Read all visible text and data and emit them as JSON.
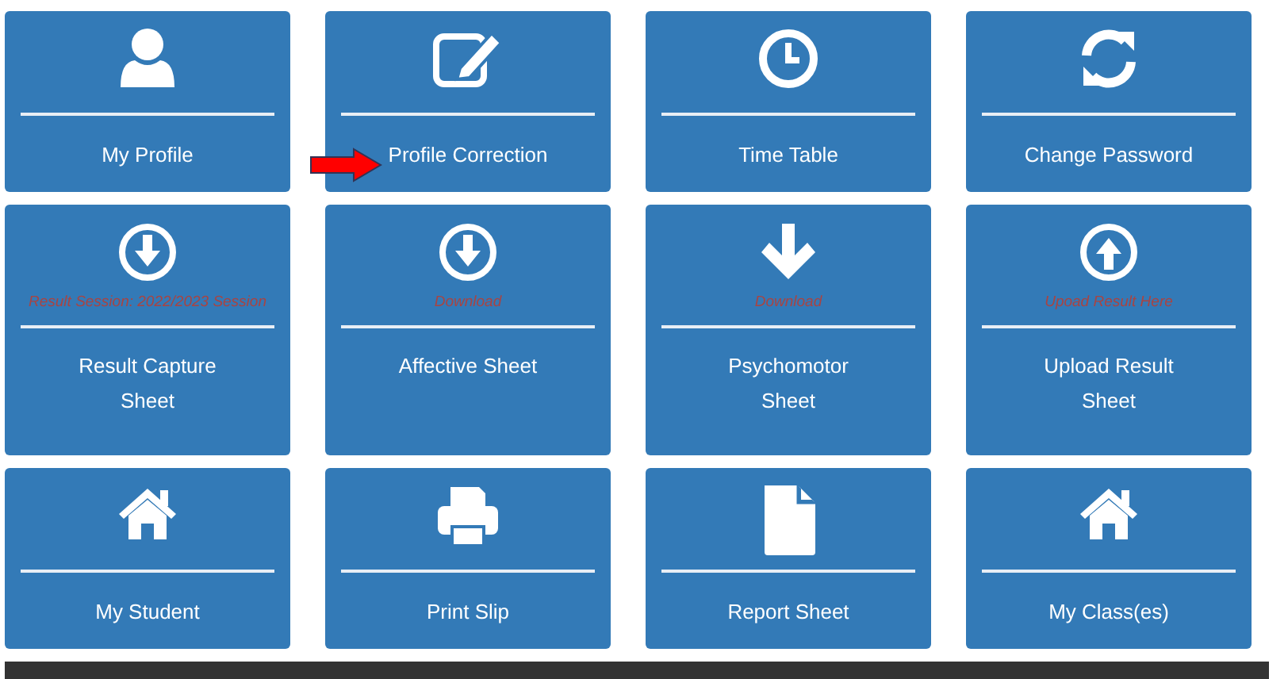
{
  "tiles": [
    {
      "kind": "user",
      "title_lines": [
        "My Profile"
      ]
    },
    {
      "kind": "edit",
      "title_lines": [
        "Profile Correction"
      ],
      "pointer": true
    },
    {
      "kind": "clock",
      "title_lines": [
        "Time Table"
      ]
    },
    {
      "kind": "refresh",
      "title_lines": [
        "Change Password"
      ]
    },
    {
      "kind": "download",
      "note": "Result Session: 2022/2023 Session",
      "title_lines": [
        "Result Capture",
        "Sheet"
      ]
    },
    {
      "kind": "download",
      "note": "Download",
      "title_lines": [
        "Affective Sheet"
      ]
    },
    {
      "kind": "arrow",
      "note": "Download",
      "title_lines": [
        "Psychomotor",
        "Sheet"
      ]
    },
    {
      "kind": "upload",
      "note": "Upoad Result Here",
      "title_lines": [
        "Upload Result",
        "Sheet"
      ]
    },
    {
      "kind": "home",
      "title_lines": [
        "My Student"
      ]
    },
    {
      "kind": "printer",
      "title_lines": [
        "Print Slip"
      ]
    },
    {
      "kind": "file",
      "title_lines": [
        "Report Sheet"
      ]
    },
    {
      "kind": "home",
      "title_lines": [
        "My Class(es)"
      ]
    }
  ]
}
